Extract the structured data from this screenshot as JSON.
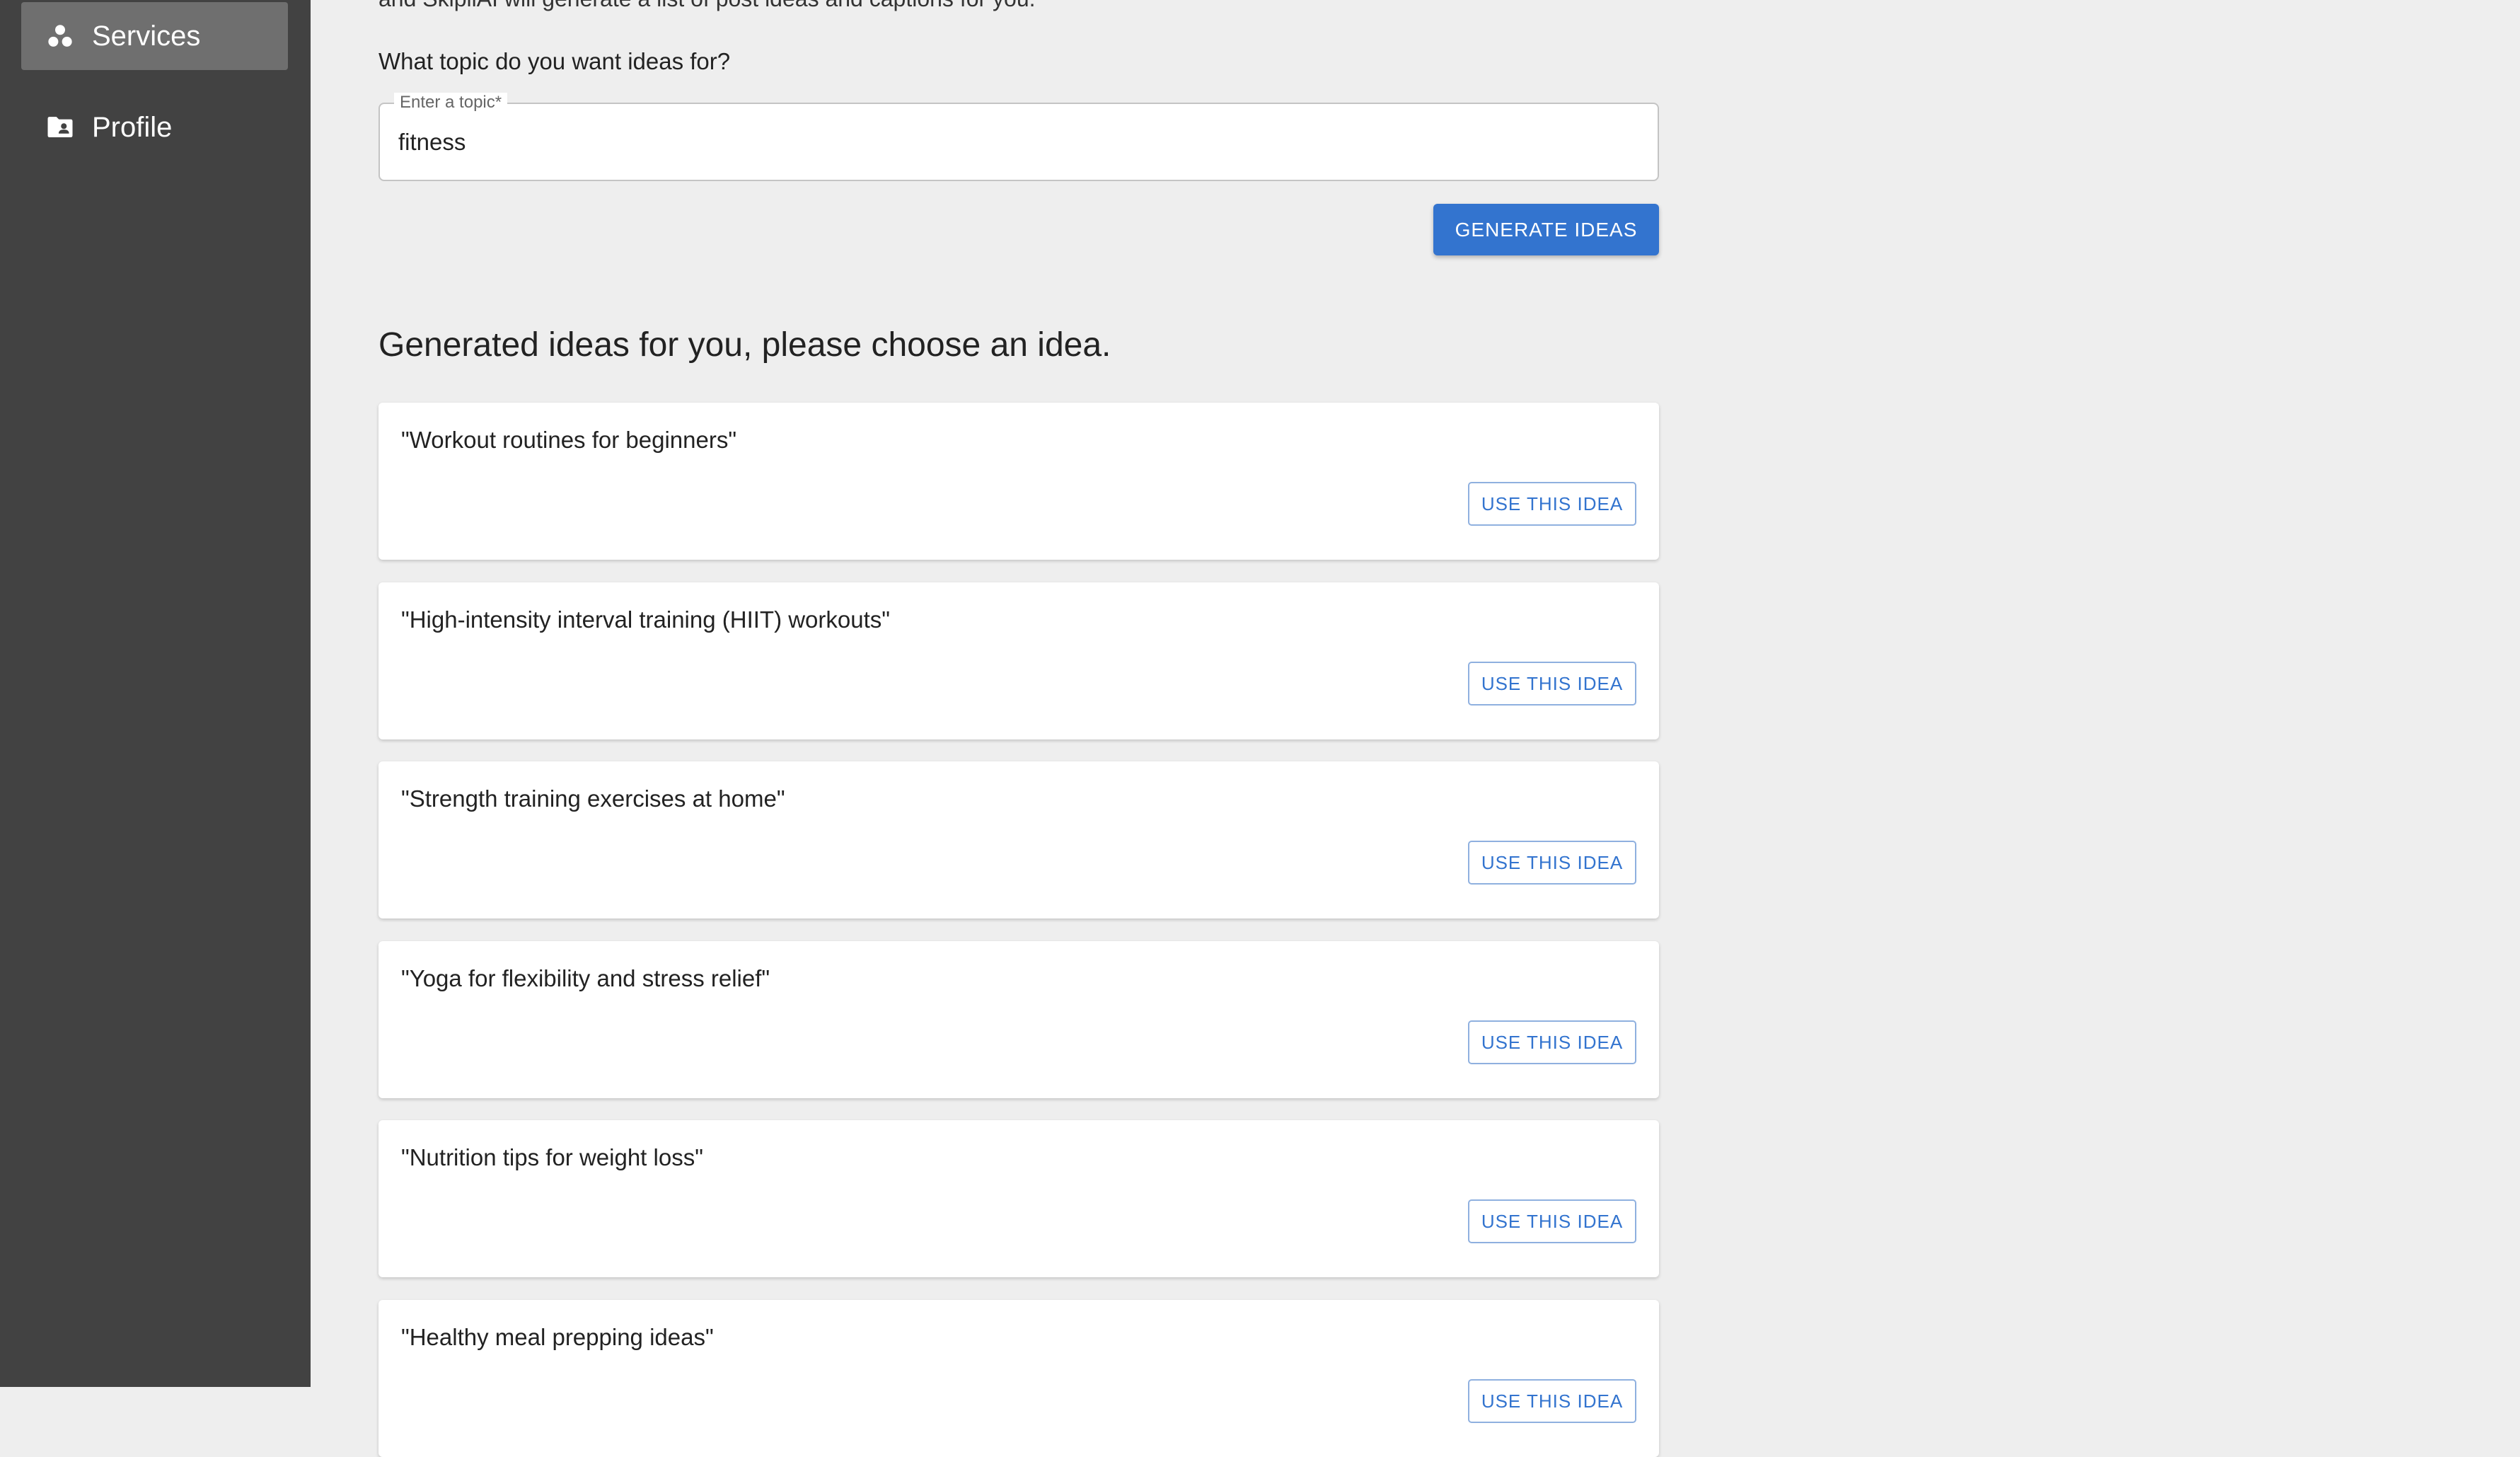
{
  "sidebar": {
    "items": [
      {
        "label": "Services",
        "icon": "services-icon",
        "active": true
      },
      {
        "label": "Profile",
        "icon": "profile-folder-icon",
        "active": false
      }
    ]
  },
  "main": {
    "intro": "and SkipliAI will generate a list of post ideas and captions for you.",
    "question": "What topic do you want ideas for?",
    "topic_field": {
      "label": "Enter a topic",
      "required_mark": "*",
      "value": "fitness"
    },
    "generate_button": "GENERATE IDEAS",
    "ideas_heading": "Generated ideas for you, please choose an idea.",
    "use_button_label": "USE THIS IDEA",
    "ideas": [
      "\"Workout routines for beginners\"",
      "\"High-intensity interval training (HIIT) workouts\"",
      "\"Strength training exercises at home\"",
      "\"Yoga for flexibility and stress relief\"",
      "\"Nutrition tips for weight loss\"",
      "\"Healthy meal prepping ideas\""
    ]
  },
  "colors": {
    "sidebar_bg": "#424242",
    "sidebar_active": "#6f6f6f",
    "page_bg": "#eeeeee",
    "accent": "#3374cf"
  }
}
